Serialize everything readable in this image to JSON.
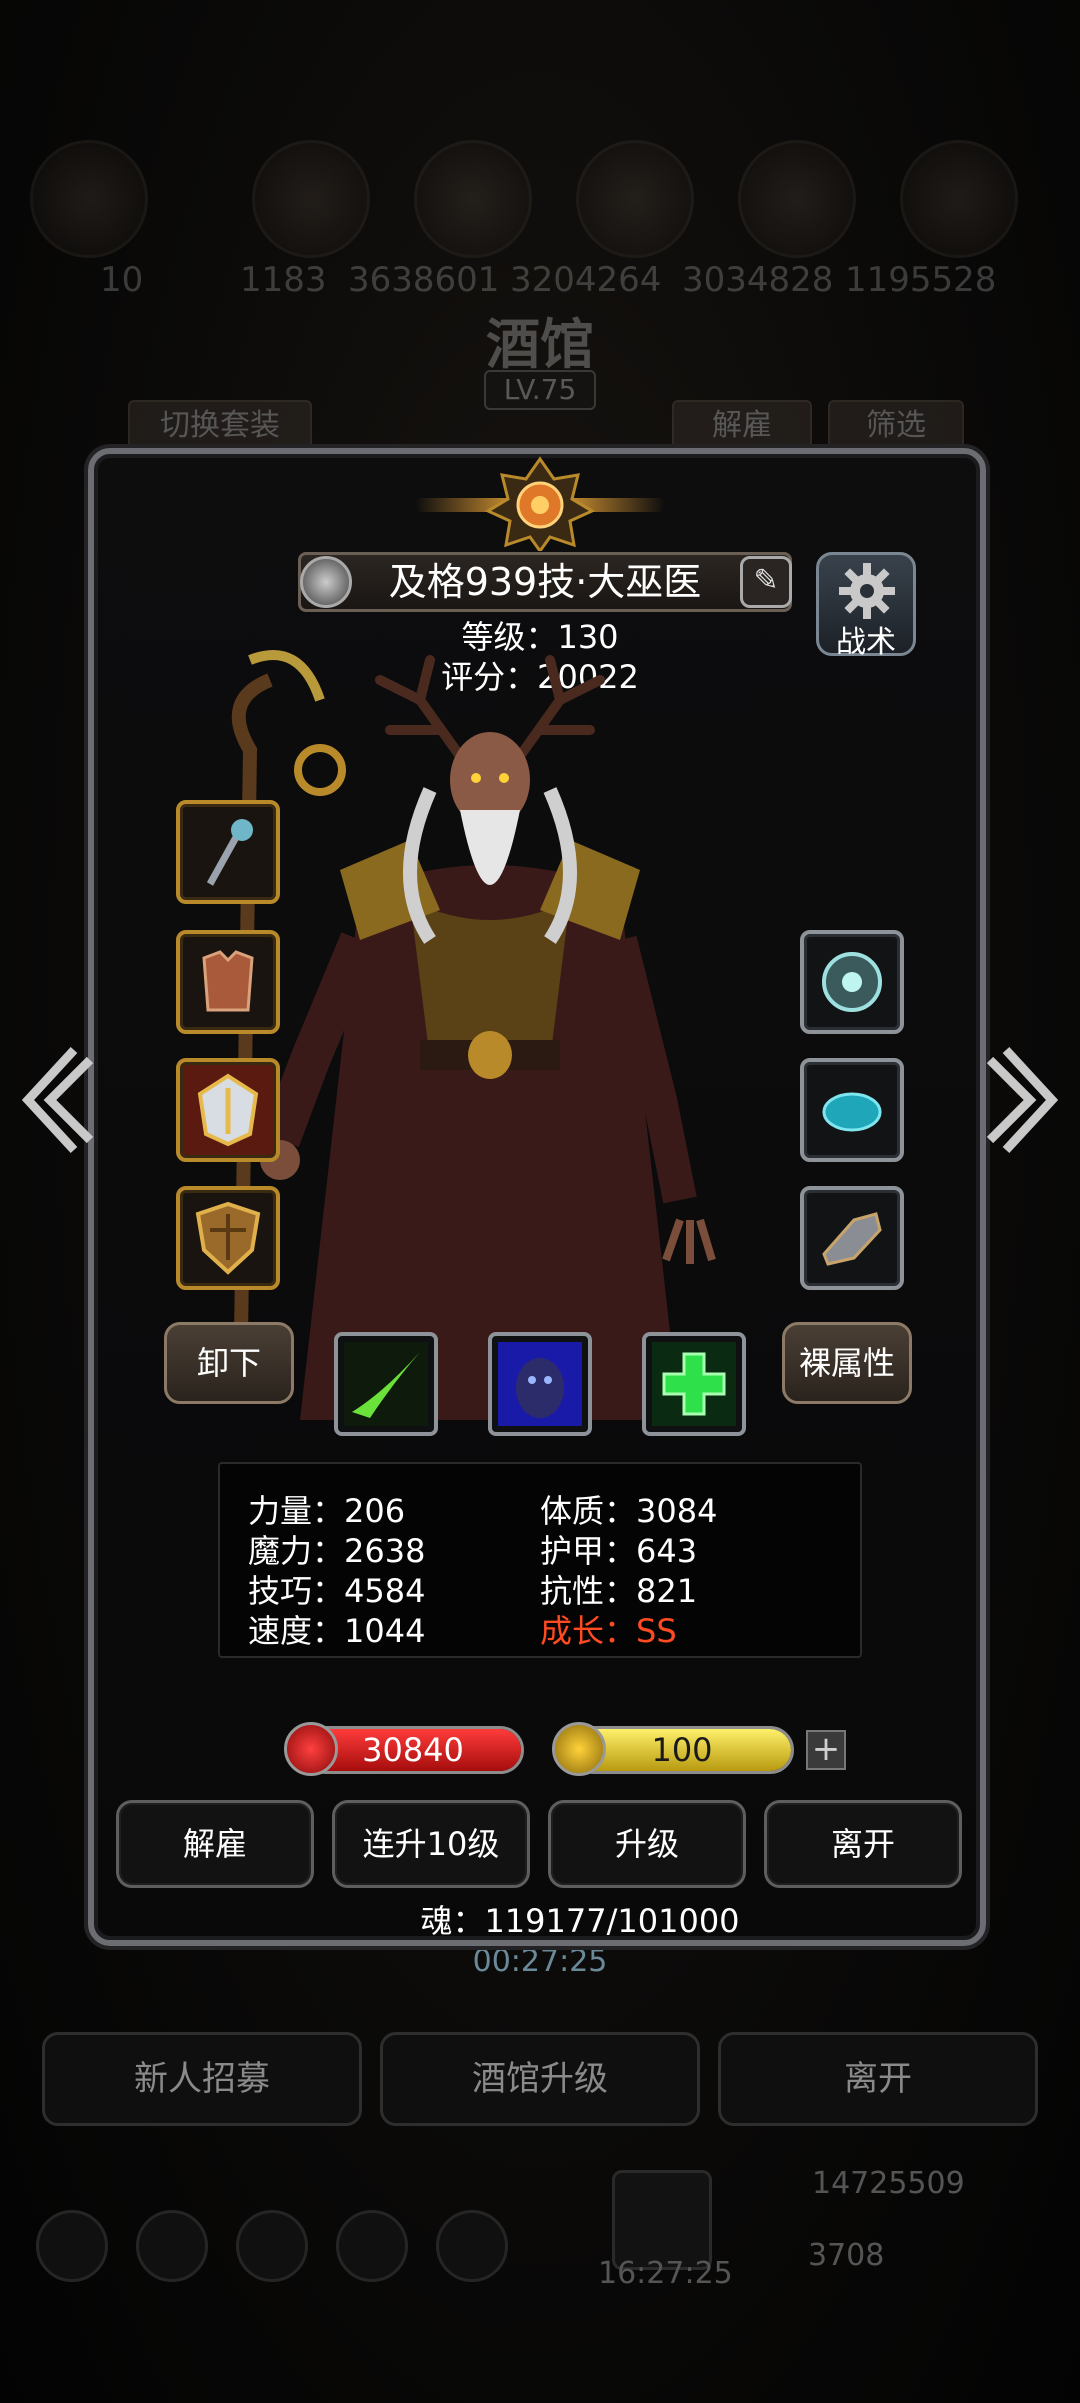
{
  "background": {
    "resources": [
      "10",
      "1183",
      "3638601",
      "3204264",
      "3034828",
      "1195528"
    ],
    "title": "酒馆",
    "level": "LV.75",
    "tabs": [
      "切换套装",
      "解雇",
      "筛选"
    ],
    "timer": "00:27:25",
    "bottom_buttons": [
      "新人招募",
      "酒馆升级",
      "离开"
    ],
    "coins": [
      "14725509",
      "3708"
    ],
    "clock": "16:27:25"
  },
  "hero": {
    "name": "及格939技·大巫医",
    "level_label": "等级：130",
    "score_label": "评分：20022",
    "tactics_label": "战术"
  },
  "equipment": {
    "left": [
      "staff-icon",
      "armor-icon",
      "helmet-icon",
      "shield-icon"
    ],
    "right": [
      "rune-stone-icon",
      "gem-icon",
      "boot-icon"
    ]
  },
  "buttons": {
    "unequip": "卸下",
    "base_attributes": "裸属性"
  },
  "skills": [
    "green-slash-icon",
    "blue-spirit-icon",
    "green-cross-icon"
  ],
  "stats": {
    "strength": "力量：206",
    "magic": "魔力：2638",
    "skill": "技巧：4584",
    "speed": "速度：1044",
    "constitution": "体质：3084",
    "armor": "护甲：643",
    "resistance": "抗性：821",
    "growth": "成长：SS"
  },
  "bars": {
    "hp": "30840",
    "hp_fill": 1.0,
    "energy": "100",
    "energy_fill": 1.0,
    "plus": "+"
  },
  "actions": [
    "解雇",
    "连升10级",
    "升级",
    "离开"
  ],
  "soul": "魂：119177/101000",
  "colors": {
    "growth": "#ff4a22",
    "hp_bar": "#d11818",
    "energy_bar": "#e3c41a",
    "frame_gold": "#b88a2a"
  }
}
